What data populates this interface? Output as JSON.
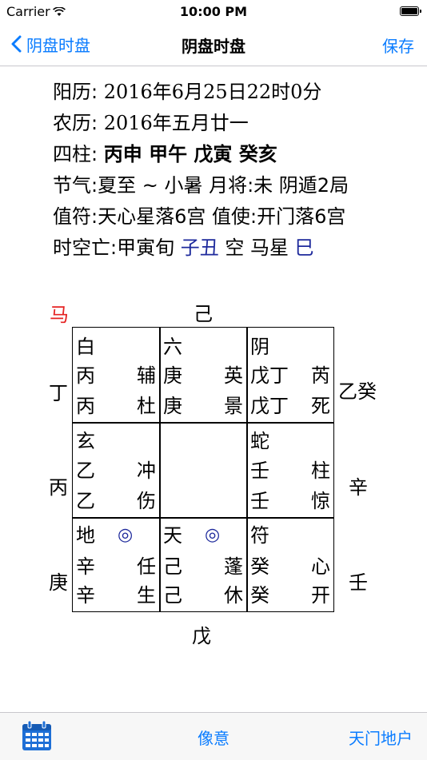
{
  "status": {
    "carrier": "Carrier",
    "time": "10:00 PM"
  },
  "nav": {
    "back": "阴盘时盘",
    "title": "阴盘时盘",
    "save": "保存"
  },
  "info": {
    "solar_label": "阳历: ",
    "solar_value": "2016年6月25日22时0分",
    "lunar_label": "农历: ",
    "lunar_value": "2016年五月廿一",
    "pillars_label": "四柱: ",
    "pillars_value": "丙申 甲午 戊寅 癸亥",
    "jieqi": "节气:夏至 ~ 小暑 月将:未 阴遁2局",
    "zhifu": "值符:天心星落6宫 值使:开门落6宫",
    "kongwang_prefix": "时空亡:甲寅旬 ",
    "kongwang_value": "子丑",
    "kongwang_mid": " 空 马星 ",
    "maxing_value": "巳"
  },
  "board": {
    "ma": "马",
    "top": "己",
    "bottom": "戊",
    "left": [
      "丁",
      "丙",
      "庚"
    ],
    "right": [
      "乙癸",
      "辛",
      "壬"
    ],
    "circle": "◎",
    "cells": [
      {
        "god": "白",
        "l1": "丙",
        "r1": "辅",
        "l2": "丙",
        "r2": "杜"
      },
      {
        "god": "六",
        "l1": "庚",
        "r1": "英",
        "l2": "庚",
        "r2": "景"
      },
      {
        "god": "阴",
        "l1": "戊丁",
        "r1": "芮",
        "l2": "戊丁",
        "r2": "死"
      },
      {
        "god": "玄",
        "l1": "乙",
        "r1": "冲",
        "l2": "乙",
        "r2": "伤"
      },
      {
        "god": "蛇",
        "l1": "壬",
        "r1": "柱",
        "l2": "壬",
        "r2": "惊"
      },
      {
        "god": "地",
        "l1": "辛",
        "r1": "任",
        "l2": "辛",
        "r2": "生"
      },
      {
        "god": "天",
        "l1": "己",
        "r1": "蓬",
        "l2": "己",
        "r2": "休"
      },
      {
        "god": "符",
        "l1": "癸",
        "r1": "心",
        "l2": "癸",
        "r2": "开"
      }
    ]
  },
  "tabbar": {
    "middle": "像意",
    "right": "天门地户"
  },
  "colors": {
    "accent": "#0a7cff",
    "red": "#e52222",
    "blue": "#1e2a9c"
  },
  "icons": [
    "wifi-icon",
    "battery-icon",
    "back-chevron-icon",
    "calendar-icon"
  ]
}
